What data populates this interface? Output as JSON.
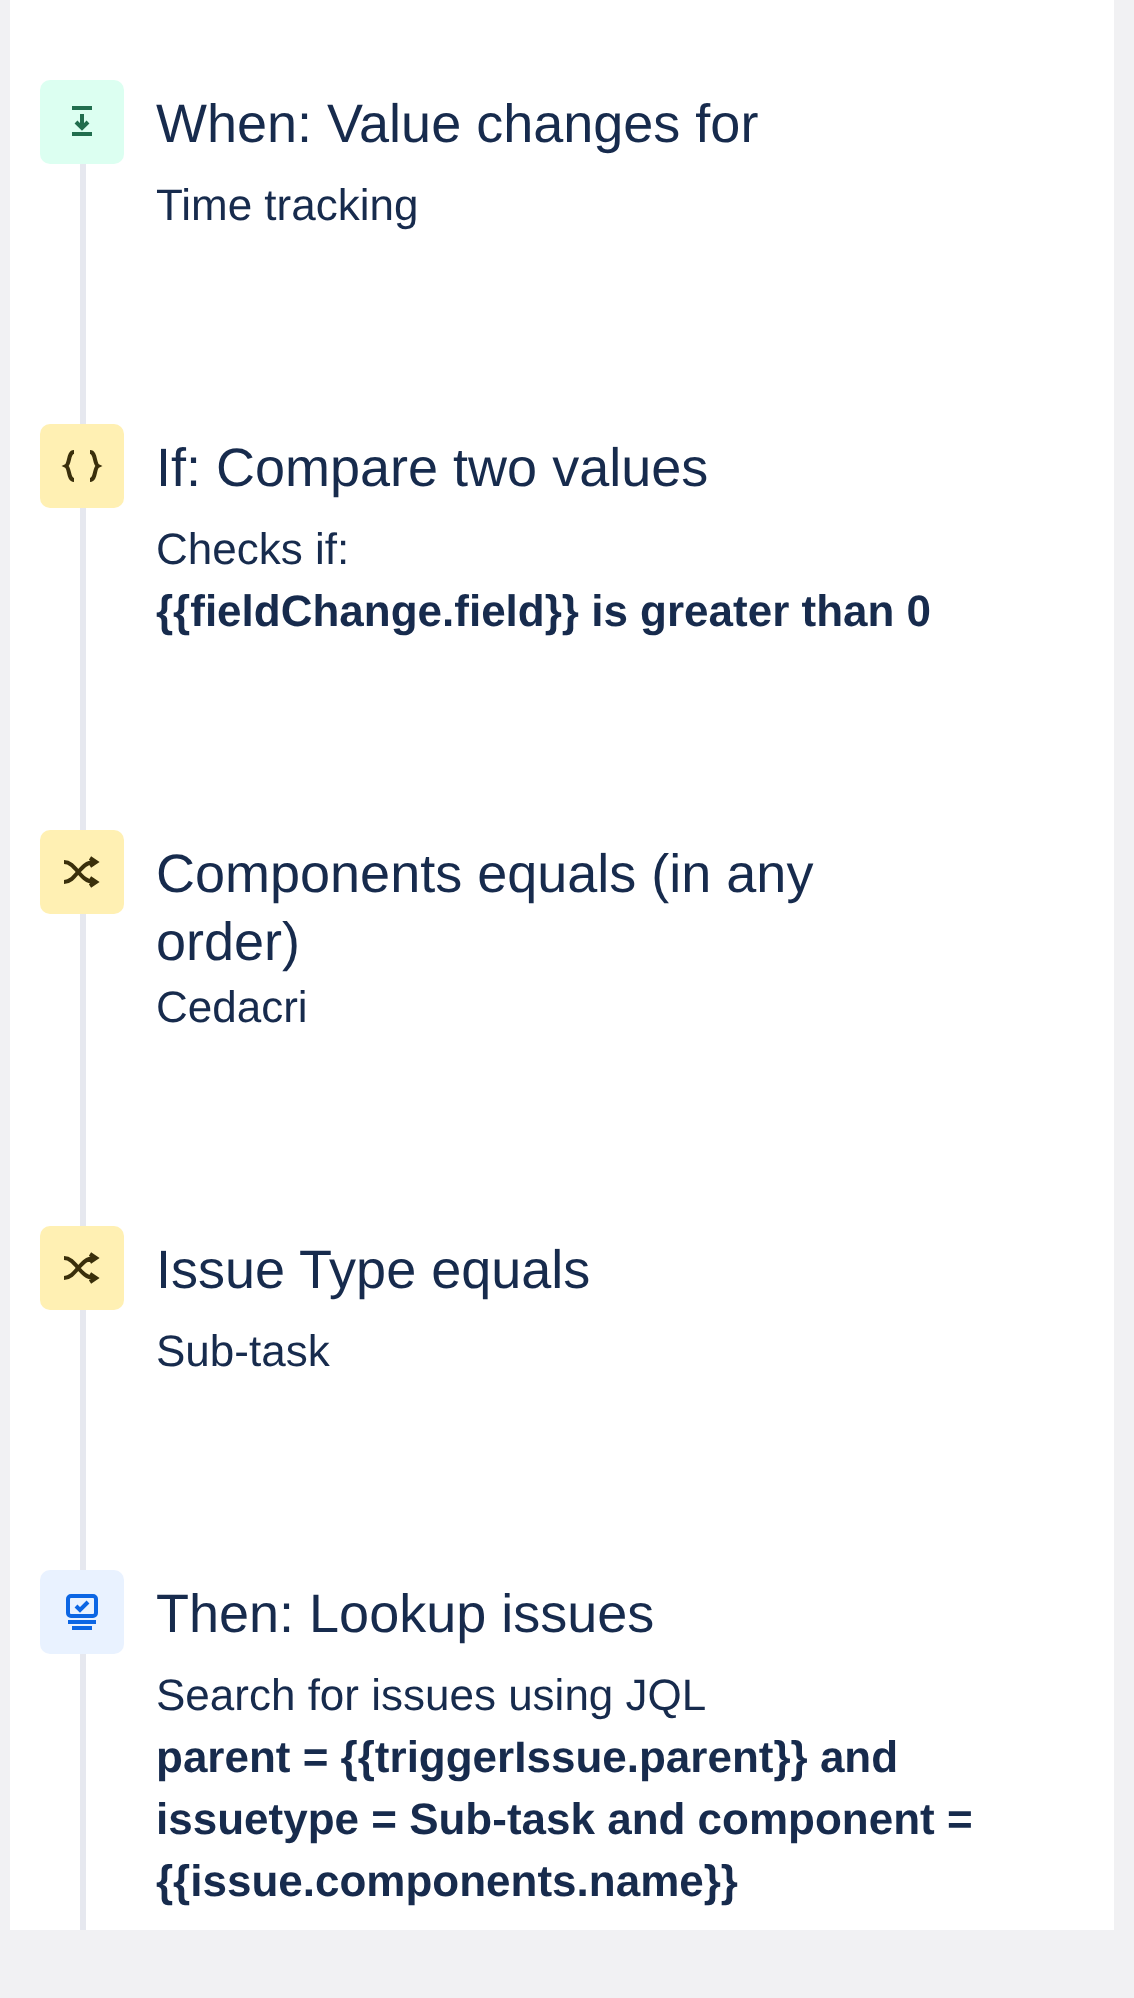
{
  "steps": [
    {
      "kind": "trigger",
      "title": "When: Value changes for",
      "detail": "Time tracking"
    },
    {
      "kind": "condition",
      "title": "If: Compare two values",
      "detail": "Checks if:\n**{{fieldChange.field}} is greater than 0**"
    },
    {
      "kind": "branch",
      "title": "Components equals (in any order)",
      "detail": "Cedacri"
    },
    {
      "kind": "branch",
      "title": "Issue Type equals",
      "detail": "Sub-task"
    },
    {
      "kind": "action",
      "title": "Then: Lookup issues",
      "detail": "Search for issues using JQL\n**parent = {{triggerIssue.parent}} and issuetype = Sub-task and component = {{issue.components.name}}**"
    }
  ]
}
